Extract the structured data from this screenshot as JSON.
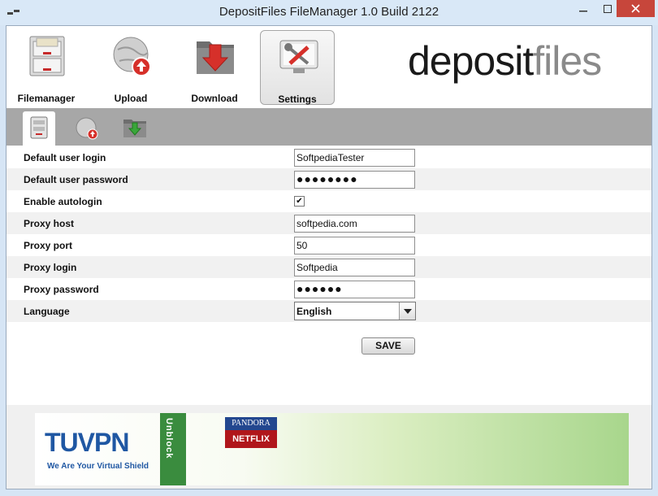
{
  "window": {
    "title": "DepositFiles FileManager 1.0 Build 2122"
  },
  "toolbar": {
    "items": [
      {
        "label": "Filemanager",
        "icon": "filemanager-cabinet-icon"
      },
      {
        "label": "Upload",
        "icon": "upload-globe-icon"
      },
      {
        "label": "Download",
        "icon": "download-folder-icon"
      },
      {
        "label": "Settings",
        "icon": "settings-tools-icon",
        "active": true
      }
    ],
    "logo": {
      "part1": "depo",
      "part2": "sit",
      "part3": "files"
    }
  },
  "subtabs": [
    {
      "icon": "server-icon",
      "active": true
    },
    {
      "icon": "globe-upload-icon"
    },
    {
      "icon": "folder-download-icon"
    }
  ],
  "form": {
    "default_user_login": {
      "label": "Default user login",
      "value": "SoftpediaTester"
    },
    "default_user_password": {
      "label": "Default user password",
      "value": "●●●●●●●●"
    },
    "enable_autologin": {
      "label": "Enable autologin",
      "checked": true,
      "mark": "✔"
    },
    "proxy_host": {
      "label": "Proxy host",
      "value": "softpedia.com"
    },
    "proxy_port": {
      "label": "Proxy port",
      "value": "50"
    },
    "proxy_login": {
      "label": "Proxy login",
      "value": "Softpedia"
    },
    "proxy_password": {
      "label": "Proxy password",
      "value": "●●●●●●"
    },
    "language": {
      "label": "Language",
      "value": "English"
    },
    "save_label": "SAVE"
  },
  "ad": {
    "brand": "TUVPN",
    "tagline": "We Are Your Virtual Shield",
    "unblock": "Unblock",
    "pandora": "PANDORA",
    "netflix": "NETFLIX"
  },
  "colors": {
    "accent_red": "#d6302a",
    "active_tab": "#ffffff",
    "subbar": "#a7a7a7"
  }
}
